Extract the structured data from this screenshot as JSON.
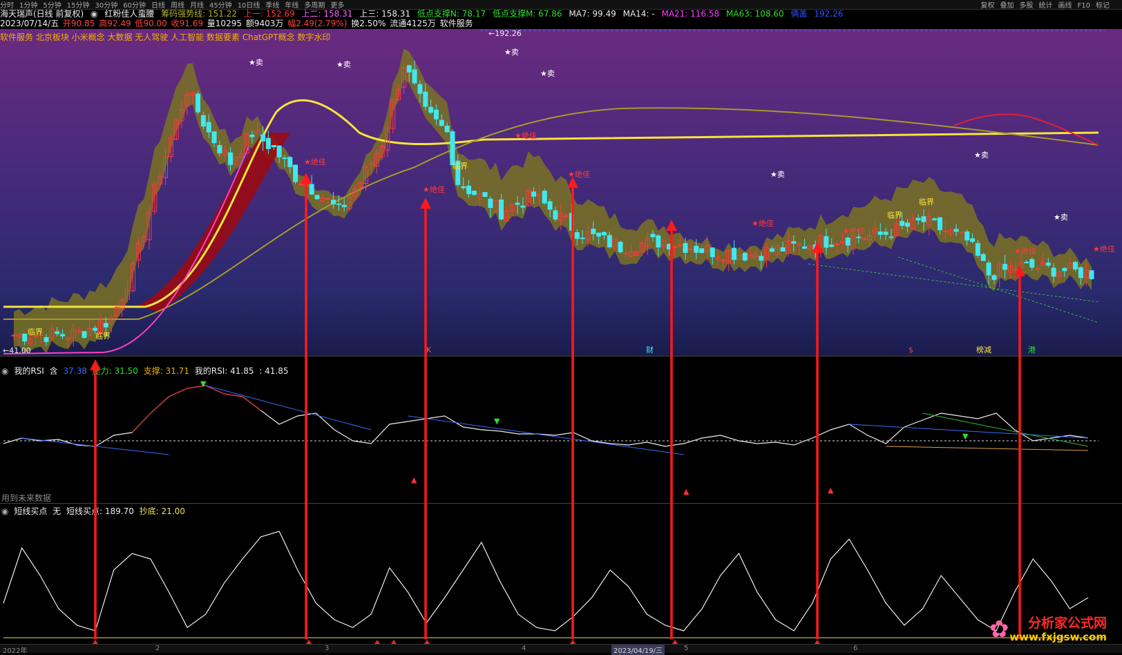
{
  "topbar": {
    "items": [
      "分时",
      "1分钟",
      "5分钟",
      "15分钟",
      "30分钟",
      "60分钟",
      "日线",
      "周线",
      "月线",
      "45分钟",
      "10日线",
      "季线",
      "年线",
      "多周期",
      "更多"
    ],
    "right_items": [
      "复权",
      "叠加",
      "多股",
      "统计",
      "画线",
      "F10",
      "标记"
    ]
  },
  "info1": {
    "stock": "海天瑞声(日线 前复权)",
    "indicator": "红粉佳人蛮腰",
    "chip_line": "筹码强势线: 151.22",
    "up1": "上一: 152.69",
    "up2": "上二: 158.31",
    "up3": "上三: 158.31",
    "low_support_n": "低点支撑N: 78.17",
    "low_support_m": "低点支撑M: 67.86",
    "ma7": "MA7: 99.49",
    "ma14": "MA14: -",
    "ma21": "MA21: 116.58",
    "ma63": "MA63: 108.60",
    "extra_label": "俩盖",
    "extra_value": "192.26"
  },
  "info2": {
    "date": "2023/07/14/五",
    "open": "开90.85",
    "high": "高92.49",
    "low": "低90.00",
    "close": "收91.69",
    "volume": "量10295",
    "amount": "额9403万",
    "change": "幅2.49(2.79%)",
    "turnover": "换2.50%",
    "float": "流通4125万",
    "sector": "软件服务"
  },
  "sectors": "软件服务 北京板块 小米概念 大数据 无人驾驶 人工智能 数据要素 ChatGPT概念 数字水印",
  "main_chart": {
    "high_label": "192.26",
    "low_label": "41.00",
    "annotations": {
      "sell": "★卖",
      "best": "★绝佳",
      "critical": "临界"
    },
    "bottom_tags": [
      "K",
      "财",
      "$",
      "榜减",
      "港"
    ]
  },
  "rsi_panel": {
    "name": "我的RSI",
    "opt": "含",
    "v1": "37.38",
    "pressure": "压力: 31.50",
    "support": "支撑: 31.71",
    "rsi_label": "我的RSI: 41.85",
    "rsi_value": ": 41.85",
    "future_note": "用到未来数据"
  },
  "short_panel": {
    "name": "短线买点",
    "opt": "无",
    "buy": "短线买点: 189.70",
    "bottom": "抄底: 21.00"
  },
  "xaxis": {
    "labels": [
      "2022年",
      "2",
      "3",
      "4",
      "2023/04/19/三",
      "5",
      "6"
    ]
  },
  "watermark": {
    "name": "分析家公式网",
    "url": "www.fxjgsw.com"
  },
  "chart_data": {
    "type": "line",
    "x": [
      1,
      2,
      3,
      4,
      5,
      6,
      7,
      8,
      9,
      10,
      11,
      12,
      13,
      14,
      15,
      16,
      17,
      18,
      19,
      20,
      21,
      22,
      23,
      24,
      25,
      26,
      27,
      28,
      29,
      30,
      31,
      32,
      33,
      34,
      35,
      36,
      37,
      38,
      39,
      40,
      41,
      42,
      43,
      44,
      45,
      46,
      47,
      48,
      49,
      50,
      51,
      52,
      53,
      54,
      55,
      56,
      57,
      58,
      59,
      60
    ],
    "series": [
      {
        "name": "我的RSI",
        "values": [
          38,
          42,
          40,
          41,
          37,
          36,
          44,
          46,
          60,
          72,
          78,
          80,
          74,
          72,
          62,
          52,
          58,
          60,
          48,
          40,
          38,
          52,
          54,
          56,
          58,
          50,
          48,
          47,
          45,
          45,
          44,
          46,
          40,
          38,
          37,
          39,
          36,
          38,
          42,
          44,
          40,
          38,
          39,
          37,
          42,
          48,
          52,
          44,
          38,
          50,
          55,
          60,
          58,
          56,
          60,
          48,
          40,
          42,
          44,
          42
        ]
      },
      {
        "name": "短线买点",
        "values": [
          30,
          80,
          55,
          25,
          10,
          5,
          60,
          75,
          70,
          40,
          8,
          20,
          48,
          70,
          90,
          95,
          60,
          30,
          15,
          8,
          20,
          62,
          40,
          12,
          35,
          60,
          85,
          50,
          20,
          8,
          5,
          18,
          35,
          60,
          45,
          20,
          10,
          5,
          25,
          55,
          75,
          40,
          15,
          5,
          30,
          70,
          88,
          60,
          30,
          10,
          25,
          55,
          35,
          15,
          5,
          40,
          70,
          50,
          25,
          35
        ]
      }
    ]
  }
}
